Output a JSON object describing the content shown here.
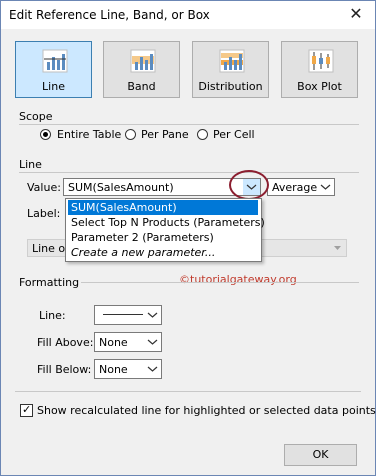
{
  "window": {
    "title": "Edit Reference Line, Band, or Box",
    "close_symbol": "✕"
  },
  "tabs": [
    {
      "label": "Line",
      "icon": "line-chart-icon",
      "active": true
    },
    {
      "label": "Band",
      "icon": "band-chart-icon",
      "active": false
    },
    {
      "label": "Distribution",
      "icon": "distribution-chart-icon",
      "active": false
    },
    {
      "label": "Box Plot",
      "icon": "box-plot-chart-icon",
      "active": false
    }
  ],
  "scope": {
    "heading": "Scope",
    "options": [
      "Entire Table",
      "Per Pane",
      "Per Cell"
    ],
    "selected": "Entire Table"
  },
  "line": {
    "heading": "Line",
    "value_label": "Value:",
    "value": "SUM(SalesAmount)",
    "aggregation": "Average",
    "label_label": "Label:",
    "tooltip_value": "Line on"
  },
  "dropdown": {
    "items": [
      "SUM(SalesAmount)",
      "Select Top N Products (Parameters)",
      "Parameter 2 (Parameters)",
      "Create a new parameter..."
    ],
    "selected_index": 0
  },
  "watermark": "©tutorialgateway.org",
  "formatting": {
    "heading": "Formatting",
    "line_label": "Line:",
    "fill_above_label": "Fill Above:",
    "fill_above_value": "None",
    "fill_below_label": "Fill Below:",
    "fill_below_value": "None"
  },
  "footer": {
    "checkbox_label": "Show recalculated line for highlighted or selected data points",
    "checkbox_checked": true,
    "ok_label": "OK"
  },
  "colors": {
    "accent": "#0078d7",
    "active_tab": "#cce8ff",
    "annotation_circle": "#8b1e2f",
    "watermark": "#c0392b"
  }
}
